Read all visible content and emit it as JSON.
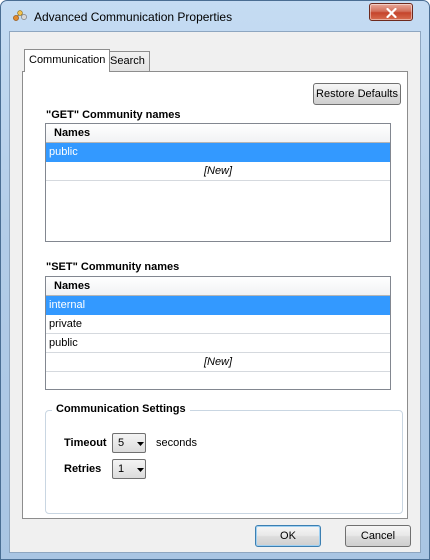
{
  "window": {
    "title": "Advanced Communication Properties"
  },
  "tabs": [
    {
      "label": "Communication",
      "active": true
    },
    {
      "label": "Search",
      "active": false
    }
  ],
  "restore_defaults_label": "Restore Defaults",
  "get_section": {
    "title": "\"GET\" Community names",
    "column_header": "Names",
    "rows": [
      "public"
    ],
    "selected_row": "public",
    "new_row_label": "[New]"
  },
  "set_section": {
    "title": "\"SET\" Community names",
    "column_header": "Names",
    "rows": [
      "internal",
      "private",
      "public"
    ],
    "selected_row": "internal",
    "new_row_label": "[New]"
  },
  "communication_settings": {
    "title": "Communication Settings",
    "timeout_label": "Timeout",
    "timeout_value": "5",
    "timeout_unit": "seconds",
    "retries_label": "Retries",
    "retries_value": "1"
  },
  "footer": {
    "ok_label": "OK",
    "cancel_label": "Cancel"
  },
  "colors": {
    "selection": "#3399ff",
    "title_bar": "#b3cde8",
    "close_button": "#c5442b"
  },
  "icons": {
    "app": "network-nodes-icon",
    "close": "close-icon",
    "dropdown": "chevron-down-icon"
  }
}
